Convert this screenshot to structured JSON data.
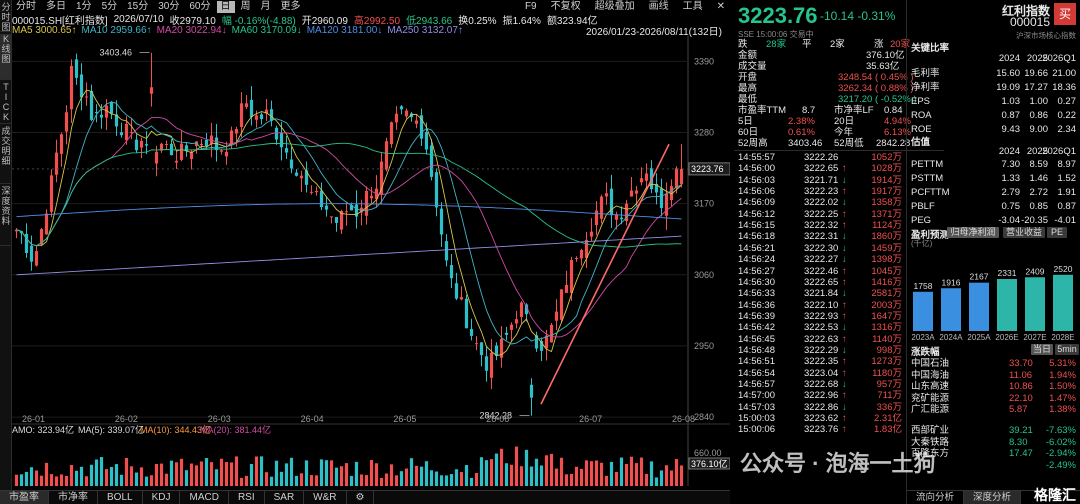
{
  "side_tabs": [
    "分时图",
    "K线图",
    "TICK",
    "成交明细",
    "深度资料"
  ],
  "toolbar": {
    "periods": [
      "分时",
      "多日",
      "1分",
      "5分",
      "15分",
      "30分",
      "60分",
      "日",
      "周",
      "月",
      "更多"
    ],
    "active_period": "日",
    "right": [
      "F9",
      "不复权",
      "超级叠加",
      "画线",
      "工具"
    ]
  },
  "info": {
    "code": "000015.SH[红利指数]",
    "date": "2026/07/10",
    "close_l": "收",
    "close": "2979.10",
    "chg_l": "幅",
    "chg": "-0.16%(-4.88)",
    "open_l": "开",
    "open": "2960.09",
    "high_l": "高",
    "high": "2992.50",
    "low_l": "低",
    "low": "2943.66",
    "turn": "换0.25%",
    "amp": "振1.64%",
    "amt": "额323.94亿"
  },
  "ma": [
    {
      "l": "MA5",
      "v": "3000.65↑",
      "c": "#d8c64a"
    },
    {
      "l": "MA10",
      "v": "2959.66↑",
      "c": "#3fb6c5"
    },
    {
      "l": "MA20",
      "v": "3022.94↓",
      "c": "#d04ca3"
    },
    {
      "l": "MA60",
      "v": "3170.09↓",
      "c": "#27c48c"
    },
    {
      "l": "MA120",
      "v": "3181.00↓",
      "c": "#4f8ee8"
    },
    {
      "l": "MA250",
      "v": "3132.07↑",
      "c": "#8f8fe8"
    }
  ],
  "range_label": "2026/01/23-2026/08/11(132日)",
  "axis": {
    "y_ticks": [
      "3390",
      "3280",
      "3170",
      "3060",
      "2950",
      "2840"
    ],
    "price_tag": "3223.76",
    "vol_ticks": [
      "660.00",
      "376.10亿"
    ],
    "x_ticks": [
      "26-01",
      "26-02",
      "26-03",
      "26-04",
      "26-05",
      "26-06",
      "26-07",
      "26-08"
    ]
  },
  "annotations": {
    "high": "3403.46",
    "low": "2842.28"
  },
  "amo": {
    "label": "AMO:",
    "v": "323.94亿",
    "ma5": "MA(5): 339.07亿",
    "ma10": "MA(10): 344.43亿",
    "ma20": "MA(20): 381.44亿"
  },
  "bottom_tabs": [
    "市盈率",
    "市净率",
    "BOLL",
    "KDJ",
    "MACD",
    "RSI",
    "SAR",
    "W&R"
  ],
  "chart_data": {
    "type": "candlestick",
    "y_range": [
      2820,
      3420
    ],
    "ohlc_note": "approx reconstruction of the visible candles",
    "highlights": {
      "high": 3403.46,
      "low": 2842.28,
      "last": 3223.76
    }
  },
  "quote": {
    "price": "3223.76",
    "chg": "-10.14",
    "pct": "-0.31%",
    "ts": "SSE 15:00:06 交易中",
    "table": [
      {
        "a": "跌",
        "b": "28家",
        "c": "平",
        "d": "2家",
        "e": "涨",
        "f": "20家"
      },
      {
        "k": "金额",
        "v": "376.10亿"
      },
      {
        "k": "成交量",
        "v": "35.63亿"
      },
      {
        "k": "开盘",
        "v": "3248.54 ( 0.45% )",
        "r": 1
      },
      {
        "k": "最高",
        "v": "3262.34 ( 0.88% )",
        "r": 1
      },
      {
        "k": "最低",
        "v": "3217.20 ( -0.52% )",
        "g": 1
      }
    ],
    "pe": {
      "l1": "市盈率TTM",
      "v1": "8.7",
      "l2": "市净率LF",
      "v2": "0.84"
    },
    "perf": [
      {
        "a": "5日",
        "b": "2.38%",
        "c": "20日",
        "d": "4.94%"
      },
      {
        "a": "60日",
        "b": "0.61%",
        "c": "今年",
        "d": "6.13%"
      }
    ],
    "w52": {
      "l": "52周高",
      "v": "3403.46",
      "l2": "52周低",
      "v2": "2842.28"
    },
    "ticks": [
      [
        "14:55:57",
        "3222.26",
        "",
        "1052万"
      ],
      [
        "14:56:00",
        "3222.65",
        "↑",
        "1028万"
      ],
      [
        "14:56:03",
        "3221.71",
        "↓",
        "1914万"
      ],
      [
        "14:56:06",
        "3222.23",
        "↑",
        "1917万"
      ],
      [
        "14:56:09",
        "3222.02",
        "↓",
        "1358万"
      ],
      [
        "14:56:12",
        "3222.25",
        "↑",
        "1371万"
      ],
      [
        "14:56:15",
        "3222.32",
        "↑",
        "1124万"
      ],
      [
        "14:56:18",
        "3222.31",
        "↓",
        "1860万"
      ],
      [
        "14:56:21",
        "3222.30",
        "↓",
        "1459万"
      ],
      [
        "14:56:24",
        "3222.27",
        "↓",
        "1398万"
      ],
      [
        "14:56:27",
        "3222.46",
        "↑",
        "1045万"
      ],
      [
        "14:56:30",
        "3222.65",
        "↑",
        "1416万"
      ],
      [
        "14:56:33",
        "3221.84",
        "↓",
        "2581万"
      ],
      [
        "14:56:36",
        "3222.10",
        "↑",
        "2003万"
      ],
      [
        "14:56:39",
        "3222.93",
        "↑",
        "1647万"
      ],
      [
        "14:56:42",
        "3222.53",
        "↓",
        "1316万"
      ],
      [
        "14:56:45",
        "3222.63",
        "↑",
        "1140万"
      ],
      [
        "14:56:48",
        "3222.29",
        "↓",
        "998万"
      ],
      [
        "14:56:51",
        "3222.35",
        "↑",
        "1273万"
      ],
      [
        "14:56:54",
        "3223.04",
        "↑",
        "1180万"
      ],
      [
        "14:56:57",
        "3222.68",
        "↓",
        "957万"
      ],
      [
        "14:57:00",
        "3222.96",
        "↑",
        "711万"
      ],
      [
        "14:57:03",
        "3222.86",
        "↓",
        "336万"
      ],
      [
        "15:00:03",
        "3223.62",
        "↑",
        "2.31亿"
      ],
      [
        "15:00:06",
        "3223.76",
        "↑",
        "1.83亿"
      ]
    ]
  },
  "fund": {
    "name": "红利指数",
    "code": "000015",
    "buy": "买",
    "cat": "沪深市场核心指数",
    "ratio_title": "关键比率",
    "years": [
      "2024",
      "2025",
      "2026Q1"
    ],
    "ratios": [
      [
        "毛利率",
        "15.60",
        "19.66",
        "21.00"
      ],
      [
        "净利率",
        "19.09",
        "17.27",
        "18.36"
      ],
      [
        "EPS",
        "1.03",
        "1.00",
        "0.27"
      ],
      [
        "ROA",
        "0.87",
        "0.86",
        "0.22"
      ],
      [
        "ROE",
        "9.43",
        "9.00",
        "2.34"
      ]
    ],
    "val_title": "估值",
    "val_years": [
      "2024",
      "2025",
      "2026Q1"
    ],
    "vals": [
      [
        "PETTM",
        "7.30",
        "8.59",
        "8.97"
      ],
      [
        "PSTTM",
        "1.33",
        "1.46",
        "1.52"
      ],
      [
        "PCFTTM",
        "2.79",
        "2.72",
        "1.91"
      ],
      [
        "PBLF",
        "0.75",
        "0.85",
        "0.87"
      ],
      [
        "PEG",
        "-3.04",
        "-20.35",
        "-4.01"
      ]
    ],
    "fc_title": "盈利预测",
    "fc_unit": "(千亿)",
    "fc_tabs": [
      "归母净利润",
      "营业收益",
      "PE"
    ],
    "forecast": {
      "type": "bar",
      "categories": [
        "2023A",
        "2024A",
        "2025A",
        "2026E",
        "2027E",
        "2028E"
      ],
      "values": [
        1758,
        1916,
        2167,
        2331,
        2409,
        2520
      ]
    },
    "rank_title": "涨跌幅",
    "rank_tabs": [
      "当日",
      "5min"
    ],
    "rank": [
      [
        "中国石油",
        "33.70",
        "5.31%",
        "r"
      ],
      [
        "中国海油",
        "11.06",
        "1.94%",
        "r"
      ],
      [
        "山东高速",
        "10.86",
        "1.50%",
        "r"
      ],
      [
        "兖矿能源",
        "22.10",
        "1.47%",
        "r"
      ],
      [
        "广汇能源",
        "5.87",
        "1.38%",
        "r"
      ],
      [
        "西部矿业",
        "39.21",
        "-7.63%",
        "g"
      ],
      [
        "大秦铁路",
        "8.30",
        "-6.02%",
        "g"
      ],
      [
        "百隆东方",
        "17.47",
        "-2.94%",
        "g"
      ],
      [
        "",
        "",
        "-2.49%",
        "g"
      ]
    ],
    "bottom": [
      "流向分析",
      "深度分析"
    ]
  },
  "watermark": "公众号 · 泡海一土狗",
  "logo": "格隆汇"
}
